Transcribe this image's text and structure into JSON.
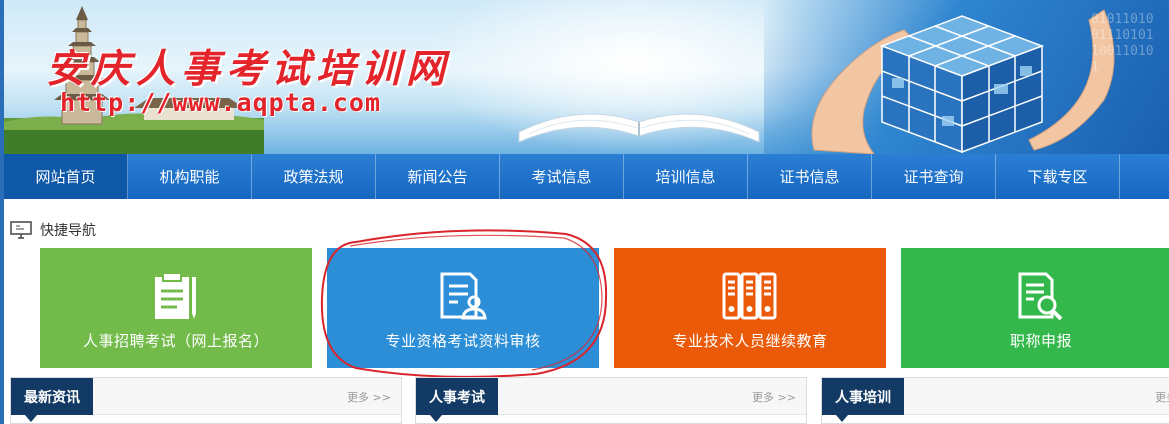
{
  "header": {
    "site_title": "安庆人事考试培训网",
    "site_url": "http://www.aqpta.com",
    "binary_text": "0101101001110101100110101"
  },
  "nav": {
    "items": [
      {
        "label": "网站首页",
        "active": true
      },
      {
        "label": "机构职能"
      },
      {
        "label": "政策法规"
      },
      {
        "label": "新闻公告"
      },
      {
        "label": "考试信息"
      },
      {
        "label": "培训信息"
      },
      {
        "label": "证书信息"
      },
      {
        "label": "证书查询"
      },
      {
        "label": "下载专区"
      }
    ]
  },
  "quick_nav": {
    "title": "快捷导航",
    "icon": "monitor-icon",
    "tiles": [
      {
        "label": "人事招聘考试（网上报名）",
        "icon": "clipboard-icon",
        "color": "#72bb4a"
      },
      {
        "label": "专业资格考试资料审核",
        "icon": "document-user-icon",
        "color": "#2b8ed6"
      },
      {
        "label": "专业技术人员继续教育",
        "icon": "binders-icon",
        "color": "#ea5a08"
      },
      {
        "label": "职称申报",
        "icon": "document-search-icon",
        "color": "#34b84c"
      }
    ]
  },
  "sections": [
    {
      "title": "最新资讯",
      "more": "更多 >>"
    },
    {
      "title": "人事考试",
      "more": "更多 >>"
    },
    {
      "title": "人事培训",
      "more": "更多 >>"
    }
  ],
  "colors": {
    "nav_bg": "#1a6cc4",
    "nav_active": "#0f58a8",
    "title_red": "#e3242b",
    "section_title_bg": "#123a64",
    "annotation_circle": "#d9252b"
  }
}
